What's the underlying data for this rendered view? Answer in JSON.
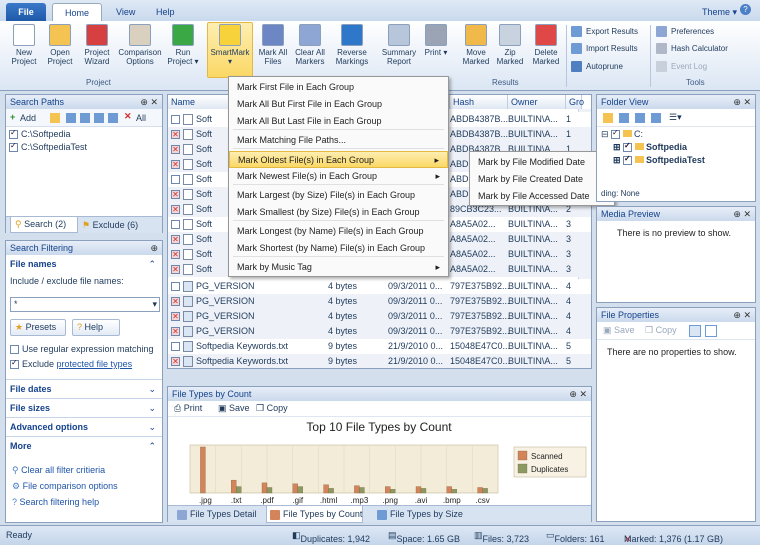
{
  "ribbon_tabs": {
    "file": "File",
    "home": "Home",
    "view": "View",
    "help": "Help",
    "theme": "Theme"
  },
  "ribbon": {
    "buttons": [
      {
        "label": "New\nProject",
        "color": "#ffffff"
      },
      {
        "label": "Open\nProject",
        "color": "#f4c352"
      },
      {
        "label": "Project\nWizard",
        "color": "#d64040"
      },
      {
        "label": "Comparison\nOptions",
        "color": "#d9d0c0"
      },
      {
        "label": "Run\nProject",
        "color": "#39a845"
      },
      {
        "label": "SmartMark",
        "color": "#f7d23a"
      },
      {
        "label": "Mark All\nFiles",
        "color": "#6d87c4"
      },
      {
        "label": "Clear All\nMarkers",
        "color": "#8ea6d4"
      },
      {
        "label": "Reverse\nMarkings",
        "color": "#2f78c9"
      },
      {
        "label": "Summary\nReport",
        "color": "#b8c6dc"
      },
      {
        "label": "Print",
        "color": "#9aa4b4"
      },
      {
        "label": "Move\nMarked",
        "color": "#f0b94a"
      },
      {
        "label": "Zip\nMarked",
        "color": "#c9d3e0"
      },
      {
        "label": "Delete\nMarked",
        "color": "#e04848"
      }
    ],
    "results_small": [
      "Export Results",
      "Import Results",
      "Autoprune"
    ],
    "tools_small": [
      "Preferences",
      "Hash Calculator",
      "Event Log"
    ],
    "groups": [
      "Project",
      "Results",
      "Tools"
    ]
  },
  "search_paths": {
    "title": "Search Paths",
    "toolbar": {
      "add": "Add",
      "all": "All"
    },
    "paths": [
      "C:\\Softpedia",
      "C:\\SoftpediaTest"
    ],
    "tabs": [
      "Search (2)",
      "Exclude (6)"
    ]
  },
  "search_filtering": {
    "title": "Search Filtering",
    "file_names_header": "File names",
    "include_label": "Include / exclude file names:",
    "include_value": "*",
    "presets": "Presets",
    "help": "Help",
    "regex": "Use regular expression matching",
    "exclude_protected_prefix": "Exclude ",
    "exclude_protected_link": "protected file types",
    "groups": [
      "File dates",
      "File sizes",
      "Advanced options",
      "More"
    ],
    "links": [
      "Clear all filter critieria",
      "File comparison options",
      "Search filtering help"
    ]
  },
  "grid": {
    "headers": [
      "Name",
      "Hash",
      "Owner",
      "Gro"
    ],
    "top_rows": [
      {
        "name": "Soft",
        "hash": "ABDB4387B...",
        "owner": "BUILTIN\\A...",
        "g": "1",
        "marked": false
      },
      {
        "name": "Soft",
        "hash": "ABDB4387B...",
        "owner": "BUILTIN\\A...",
        "g": "1",
        "marked": true
      },
      {
        "name": "Soft",
        "hash": "ABDB4387B...",
        "owner": "BUILTIN\\A...",
        "g": "1",
        "marked": true
      },
      {
        "name": "Soft",
        "hash": "ABDB4387B...",
        "owner": "BUILTIN\\A...",
        "g": "1",
        "marked": true
      },
      {
        "name": "Soft",
        "hash": "ABDB4387B...",
        "owner": "BUILTIN\\A...",
        "g": "1",
        "marked": false
      },
      {
        "name": "Soft",
        "hash": "ABDB4387B...",
        "owner": "BUILTIN\\A...",
        "g": "1",
        "marked": true
      },
      {
        "name": "Soft",
        "hash": "89CB3C23...",
        "owner": "BUILTIN\\A...",
        "g": "2",
        "marked": true
      },
      {
        "name": "Soft",
        "hash": "A8A5A02...",
        "owner": "BUILTIN\\A...",
        "g": "3",
        "marked": false
      },
      {
        "name": "Soft",
        "hash": "A8A5A02...",
        "owner": "BUILTIN\\A...",
        "g": "3",
        "marked": true
      },
      {
        "name": "Soft",
        "hash": "A8A5A02...",
        "owner": "BUILTIN\\A...",
        "g": "3",
        "marked": true
      },
      {
        "name": "Soft",
        "hash": "A8A5A02...",
        "owner": "BUILTIN\\A...",
        "g": "3",
        "marked": true
      }
    ],
    "bottom_rows": [
      {
        "name": "PG_VERSION",
        "size": "4 bytes",
        "date": "09/3/2011 0...",
        "hash": "797E375B92...",
        "owner": "BUILTIN\\A...",
        "g": "4",
        "marked": false
      },
      {
        "name": "PG_VERSION",
        "size": "4 bytes",
        "date": "09/3/2011 0...",
        "hash": "797E375B92...",
        "owner": "BUILTIN\\A...",
        "g": "4",
        "marked": true
      },
      {
        "name": "PG_VERSION",
        "size": "4 bytes",
        "date": "09/3/2011 0...",
        "hash": "797E375B92...",
        "owner": "BUILTIN\\A...",
        "g": "4",
        "marked": true
      },
      {
        "name": "PG_VERSION",
        "size": "4 bytes",
        "date": "09/3/2011 0...",
        "hash": "797E375B92...",
        "owner": "BUILTIN\\A...",
        "g": "4",
        "marked": true
      },
      {
        "name": "Softpedia Keywords.txt",
        "size": "9 bytes",
        "date": "21/9/2010 0...",
        "hash": "15048E47C0...",
        "owner": "BUILTIN\\A...",
        "g": "5",
        "marked": false
      },
      {
        "name": "Softpedia Keywords.txt",
        "size": "9 bytes",
        "date": "21/9/2010 0...",
        "hash": "15048E47C0...",
        "owner": "BUILTIN\\A...",
        "g": "5",
        "marked": true
      }
    ]
  },
  "smartmark_menu": [
    "Mark First File in Each Group",
    "Mark All But First File in Each Group",
    "Mark All But Last File in Each Group",
    "Mark Matching File Paths...",
    "Mark Oldest File(s) in Each Group",
    "Mark Newest File(s) in Each Group",
    "Mark Largest (by Size) File(s) in Each Group",
    "Mark Smallest (by Size) File(s) in Each Group",
    "Mark Longest (by Name) File(s) in Each Group",
    "Mark Shortest (by Name) File(s)  in Each Group",
    "Mark by Music Tag"
  ],
  "submenu": [
    "Mark by File Modified Date",
    "Mark by File Created Date",
    "Mark by File Accessed Date"
  ],
  "chart_panel": {
    "title": "File Types by Count",
    "toolbar": {
      "print": "Print",
      "save": "Save",
      "copy": "Copy"
    },
    "tabs": [
      "File Types Detail",
      "File Types by Count",
      "File Types by Size"
    ]
  },
  "chart_data": {
    "type": "bar",
    "title": "Top 10 File Types by Count",
    "categories": [
      ".jpg",
      ".txt",
      ".pdf",
      ".gif",
      ".html",
      ".mp3",
      ".png",
      ".avi",
      ".bmp",
      ".csv"
    ],
    "series": [
      {
        "name": "Scanned",
        "color": "#d4845a",
        "values": [
          100,
          28,
          22,
          20,
          18,
          16,
          14,
          14,
          14,
          12
        ]
      },
      {
        "name": "Duplicates",
        "color": "#8a9a62",
        "values": [
          0,
          14,
          12,
          14,
          10,
          12,
          8,
          10,
          8,
          10
        ]
      }
    ],
    "xlabel": "",
    "ylabel": "",
    "legend": "right"
  },
  "folder_view": {
    "title": "Folder View",
    "root": "C:",
    "items": [
      "Softpedia",
      "SoftpediaTest"
    ],
    "status": "ding: None"
  },
  "media_preview": {
    "title": "Media Preview",
    "text": "There is no preview to show."
  },
  "file_properties": {
    "title": "File Properties",
    "save": "Save",
    "copy": "Copy",
    "text": "There are no properties to show."
  },
  "status": {
    "ready": "Ready",
    "duplicates": "Duplicates: 1,942",
    "space": "Space: 1.65 GB",
    "files": "Files: 3,723",
    "folders": "Folders: 161",
    "marked": "Marked: 1,376 (1.17 GB)"
  }
}
